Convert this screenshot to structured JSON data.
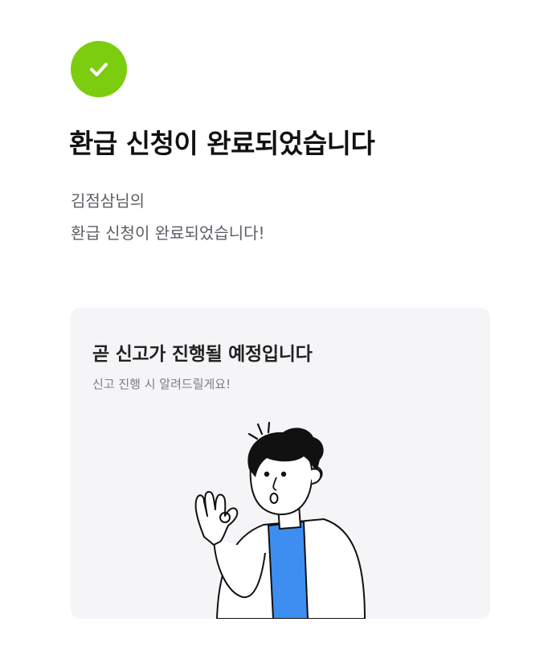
{
  "status": {
    "icon": "check-icon",
    "color": "#7ccc10"
  },
  "title": "환급 신청이 완료되었습니다",
  "description": {
    "line1": "김점삼님의",
    "line2": "환급 신청이 완료되었습니다!"
  },
  "card": {
    "title": "곧 신고가 진행될 예정입니다",
    "subtitle": "신고 진행 시 알려드릴게요!",
    "illustration": "person-ok-gesture-illustration",
    "shirt_color": "#3d8ef0"
  }
}
